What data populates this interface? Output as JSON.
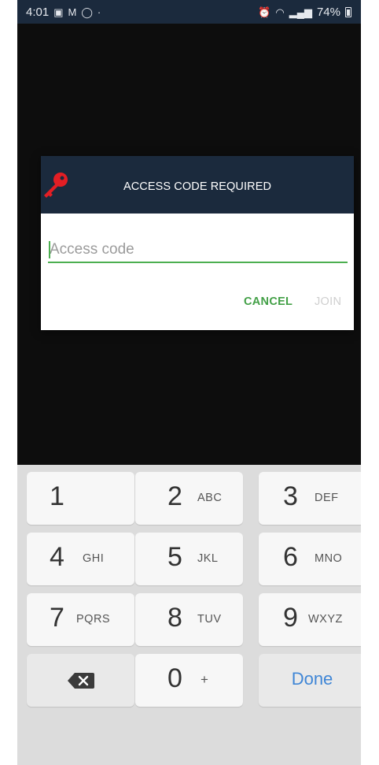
{
  "status_bar": {
    "time": "4:01",
    "notif_icons": [
      "image-notification-icon",
      "gmail-icon",
      "whatsapp-icon"
    ],
    "dot": "·",
    "battery_text": "74%",
    "right_icons": [
      "alarm-icon",
      "wifi-icon",
      "signal-icon",
      "battery-icon"
    ]
  },
  "dialog": {
    "title": "ACCESS CODE REQUIRED",
    "input_placeholder": "Access code",
    "input_value": "",
    "cancel_label": "CANCEL",
    "join_label": "JOIN"
  },
  "keyboard": {
    "keys": [
      {
        "num": "1",
        "letters": ""
      },
      {
        "num": "2",
        "letters": "ABC"
      },
      {
        "num": "3",
        "letters": "DEF"
      },
      {
        "num": "4",
        "letters": "GHI"
      },
      {
        "num": "5",
        "letters": "JKL"
      },
      {
        "num": "6",
        "letters": "MNO"
      },
      {
        "num": "7",
        "letters": "PQRS"
      },
      {
        "num": "8",
        "letters": "TUV"
      },
      {
        "num": "9",
        "letters": "WXYZ"
      },
      {
        "num": "0",
        "letters": "+"
      }
    ],
    "done_label": "Done"
  },
  "colors": {
    "header": "#1b2a3d",
    "accent_green": "#43a047",
    "done_blue": "#3f86d6",
    "key_red": "#e31e24"
  }
}
